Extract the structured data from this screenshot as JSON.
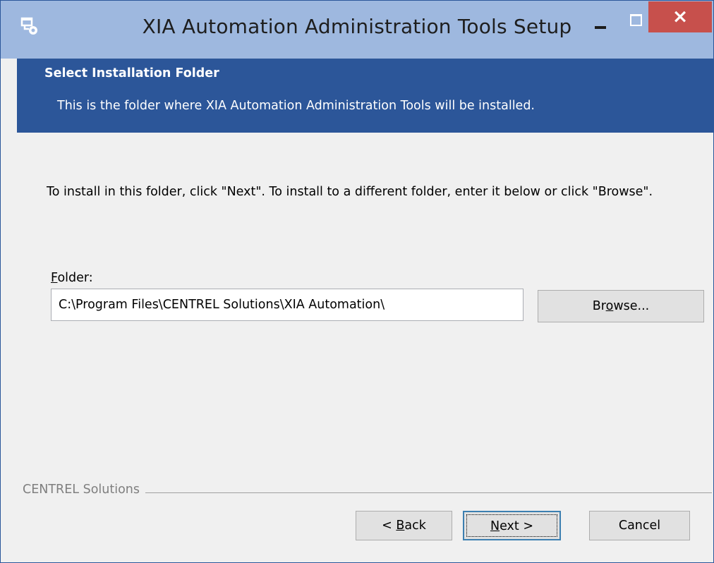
{
  "window": {
    "title": "XIA Automation Administration Tools Setup",
    "close_symbol": "×",
    "icon": "setup-icon"
  },
  "header": {
    "title": "Select Installation Folder",
    "subtitle": "This is the folder where XIA Automation Administration Tools will be installed."
  },
  "content": {
    "instructions": "To install in this folder, click \"Next\". To install to a different folder, enter it below or click \"Browse\".",
    "folder_label_prefix": "",
    "folder_label_accel": "F",
    "folder_label_rest": "older:",
    "folder_value": "C:\\Program Files\\CENTREL Solutions\\XIA Automation\\",
    "browse_prefix": "Br",
    "browse_accel": "o",
    "browse_rest": "wse..."
  },
  "footer": {
    "group_label": "CENTREL Solutions",
    "back_prefix": "< ",
    "back_accel": "B",
    "back_rest": "ack",
    "next_prefix": "",
    "next_accel": "N",
    "next_rest": "ext >",
    "cancel_label": "Cancel"
  },
  "colors": {
    "header_bg": "#2c5699",
    "titlebar_bg": "#9eb8df",
    "close_bg": "#c7504c",
    "focus_border": "#3c7fb1"
  }
}
